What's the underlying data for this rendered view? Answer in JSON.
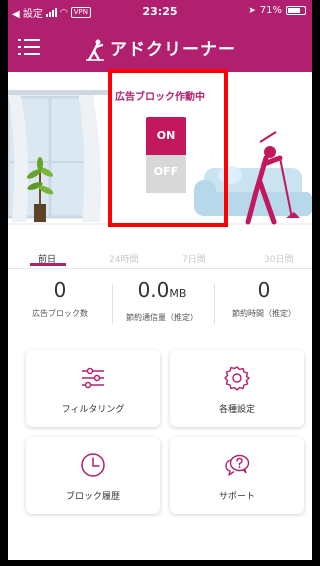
{
  "status_bar": {
    "back_label": "◀ 設定",
    "vpn": "VPN",
    "time": "23:25",
    "battery": "71%"
  },
  "header": {
    "title": "アドクリーナー"
  },
  "toggle": {
    "title": "広告ブロック作動中",
    "on_label": "ON",
    "off_label": "OFF"
  },
  "tabs": [
    {
      "label": "前日"
    },
    {
      "label": "24時間"
    },
    {
      "label": "7日間"
    },
    {
      "label": "30日間"
    }
  ],
  "stats": [
    {
      "value": "0",
      "unit": "",
      "label": "広告ブロック数"
    },
    {
      "value": "0.0",
      "unit": "MB",
      "label": "節約通信量（推定）"
    },
    {
      "value": "0",
      "unit": "",
      "label": "節約時間（推定）"
    }
  ],
  "cards": [
    {
      "label": "フィルタリング",
      "icon": "sliders-icon"
    },
    {
      "label": "各種設定",
      "icon": "gear-icon"
    },
    {
      "label": "ブロック履歴",
      "icon": "clock-icon"
    },
    {
      "label": "サポート",
      "icon": "chat-question-icon"
    }
  ],
  "colors": {
    "brand": "#b0206e",
    "highlight": "#ff0000"
  }
}
